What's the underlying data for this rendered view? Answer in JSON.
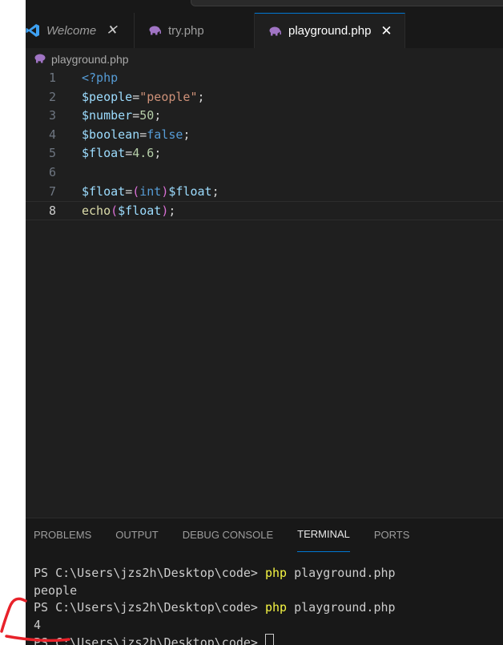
{
  "tabs": [
    {
      "label": "Welcome",
      "icon": "vscode-logo-icon"
    },
    {
      "label": "try.php",
      "icon": "php-elephant-icon"
    },
    {
      "label": "playground.php",
      "icon": "php-elephant-icon",
      "active": true
    }
  ],
  "breadcrumb": {
    "file": "playground.php"
  },
  "editor": {
    "lines": [
      {
        "num": "1",
        "tokens": [
          {
            "t": "<?php",
            "c": "tag"
          }
        ]
      },
      {
        "num": "2",
        "tokens": [
          {
            "t": "$people",
            "c": "var"
          },
          {
            "t": "=",
            "c": "op"
          },
          {
            "t": "\"people\"",
            "c": "str"
          },
          {
            "t": ";",
            "c": "op"
          }
        ]
      },
      {
        "num": "3",
        "tokens": [
          {
            "t": "$number",
            "c": "var"
          },
          {
            "t": "=",
            "c": "op"
          },
          {
            "t": "50",
            "c": "num"
          },
          {
            "t": ";",
            "c": "op"
          }
        ]
      },
      {
        "num": "4",
        "tokens": [
          {
            "t": "$boolean",
            "c": "var"
          },
          {
            "t": "=",
            "c": "op"
          },
          {
            "t": "false",
            "c": "kw"
          },
          {
            "t": ";",
            "c": "op"
          }
        ]
      },
      {
        "num": "5",
        "tokens": [
          {
            "t": "$float",
            "c": "var"
          },
          {
            "t": "=",
            "c": "op"
          },
          {
            "t": "4.6",
            "c": "num"
          },
          {
            "t": ";",
            "c": "op"
          }
        ]
      },
      {
        "num": "6",
        "tokens": []
      },
      {
        "num": "7",
        "tokens": [
          {
            "t": "$float",
            "c": "var"
          },
          {
            "t": "=",
            "c": "op"
          },
          {
            "t": "(",
            "c": "paren"
          },
          {
            "t": "int",
            "c": "kw"
          },
          {
            "t": ")",
            "c": "paren"
          },
          {
            "t": "$float",
            "c": "var"
          },
          {
            "t": ";",
            "c": "op"
          }
        ]
      },
      {
        "num": "8",
        "tokens": [
          {
            "t": "echo",
            "c": "fn"
          },
          {
            "t": "(",
            "c": "paren"
          },
          {
            "t": "$float",
            "c": "var"
          },
          {
            "t": ")",
            "c": "paren"
          },
          {
            "t": ";",
            "c": "op"
          }
        ],
        "active": true
      }
    ]
  },
  "panel": {
    "tabs": [
      "PROBLEMS",
      "OUTPUT",
      "DEBUG CONSOLE",
      "TERMINAL",
      "PORTS"
    ],
    "active_tab": "TERMINAL"
  },
  "terminal": {
    "lines": [
      {
        "prompt": "PS C:\\Users\\jzs2h\\Desktop\\code> ",
        "cmd": "php",
        "args": " playground.php"
      },
      {
        "output": "people"
      },
      {
        "prompt": "PS C:\\Users\\jzs2h\\Desktop\\code> ",
        "cmd": "php",
        "args": " playground.php"
      },
      {
        "output": "4"
      },
      {
        "prompt": "PS C:\\Users\\jzs2h\\Desktop\\code> ",
        "cursor": true
      }
    ]
  },
  "colors": {
    "accent": "#0078d4",
    "annotation": "#e8222a"
  }
}
